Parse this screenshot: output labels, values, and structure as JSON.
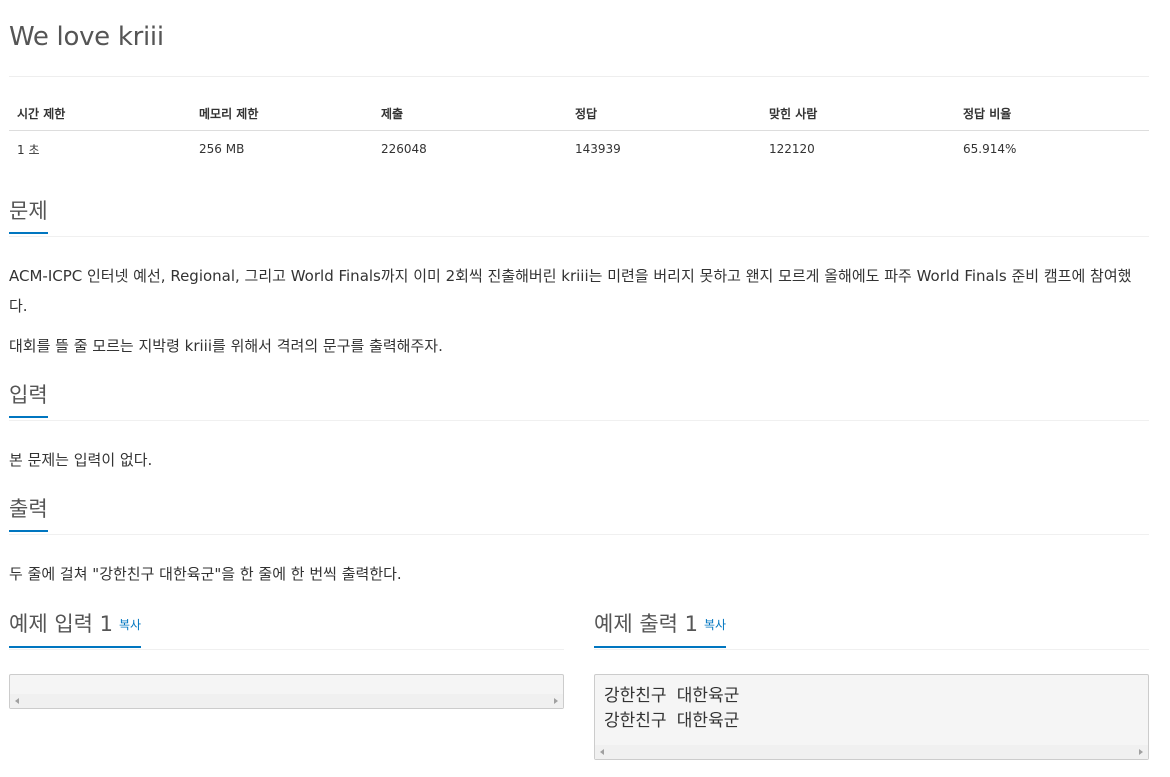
{
  "problem": {
    "title": "We love kriii"
  },
  "info_table": {
    "headers": [
      "시간 제한",
      "메모리 제한",
      "제출",
      "정답",
      "맞힌 사람",
      "정답 비율"
    ],
    "values": [
      "1 초",
      "256 MB",
      "226048",
      "143939",
      "122120",
      "65.914%"
    ]
  },
  "sections": {
    "description": {
      "heading": "문제",
      "paragraphs": [
        "ACM-ICPC 인터넷 예선, Regional, 그리고 World Finals까지 이미 2회씩 진출해버린 kriii는 미련을 버리지 못하고 왠지 모르게 올해에도 파주 World Finals 준비 캠프에 참여했다.",
        "대회를 뜰 줄 모르는 지박령 kriii를 위해서 격려의 문구를 출력해주자."
      ]
    },
    "input": {
      "heading": "입력",
      "text": "본 문제는 입력이 없다."
    },
    "output": {
      "heading": "출력",
      "text": "두 줄에 걸쳐 \"강한친구 대한육군\"을 한 줄에 한 번씩 출력한다."
    }
  },
  "samples": {
    "input": {
      "heading": "예제 입력 1",
      "copy_label": "복사",
      "content": ""
    },
    "output": {
      "heading": "예제 출력 1",
      "copy_label": "복사",
      "content": "강한친구 대한육군\n강한친구 대한육군"
    }
  },
  "colors": {
    "accent": "#0076c0",
    "heading_text": "#555555",
    "body_text": "#333333",
    "sample_bg": "#f5f5f5"
  }
}
